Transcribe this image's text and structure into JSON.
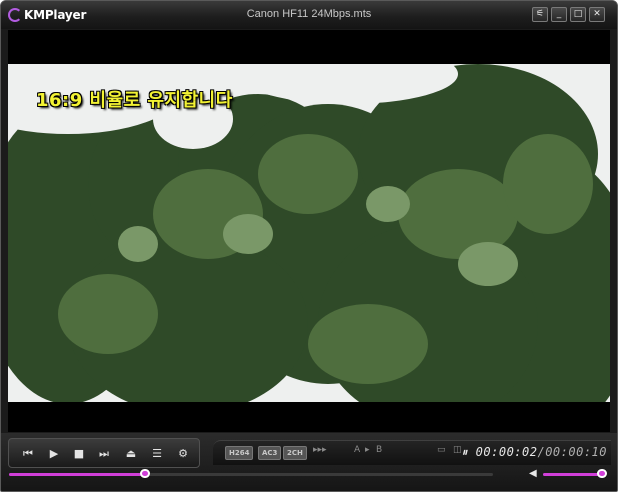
{
  "app": {
    "logo_text": "KMPlayer",
    "window_title": "Canon HF11 24Mbps.mts"
  },
  "window_buttons": {
    "settings": "⚟",
    "minimize": "_",
    "maximize": "□",
    "close": "✕"
  },
  "video": {
    "osd_message": "16:9 비율로 유지합니다"
  },
  "controls": {
    "prev": "⏮",
    "play": "▶",
    "stop": "■",
    "next": "⏭",
    "eject": "⏏",
    "playlist": "☰",
    "settings": "⚙"
  },
  "info": {
    "video_codec": "H264",
    "audio_codec": "AC3",
    "channels": "2CH",
    "speed_indicator": "▸▸▸",
    "ab_a": "A",
    "ab_b": "B",
    "pause_indicator": "⏸",
    "current_time": "00:00:02",
    "separator": "/",
    "total_time": "00:00:10"
  },
  "seek": {
    "progress_fraction": 0.28
  },
  "volume": {
    "icon": "◀",
    "level_fraction": 0.95
  },
  "colors": {
    "accent": "#d13fd9",
    "osd_text": "#f2f233",
    "window_bg": "#1b1b1b"
  }
}
